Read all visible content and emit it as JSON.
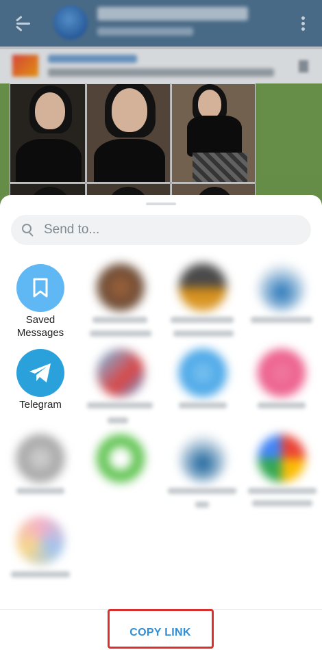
{
  "share_sheet": {
    "search_placeholder": "Send to...",
    "targets": [
      {
        "label_line1": "Saved",
        "label_line2": "Messages",
        "icon": "bookmark-icon",
        "color": "#5fb8f4"
      },
      {
        "label_line1": "Telegram",
        "icon": "telegram-plane-icon",
        "color": "#2aa1da"
      }
    ],
    "copy_link_label": "COPY LINK"
  },
  "colors": {
    "accent": "#2f8ed6",
    "header": "#4f7392",
    "highlight_box": "#d9302b"
  }
}
